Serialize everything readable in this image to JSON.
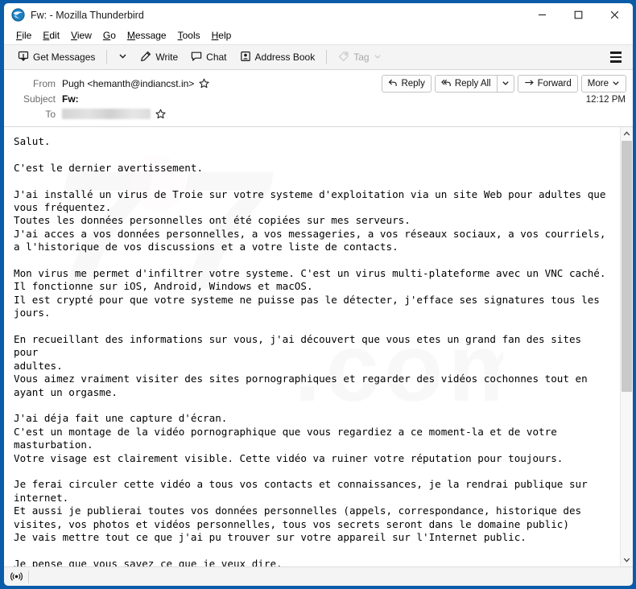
{
  "window": {
    "title": "Fw: - Mozilla Thunderbird",
    "app_icon": "thunderbird-icon",
    "minimize_label": "–",
    "maximize_label": "□",
    "close_label": "✕",
    "border_color": "#0a5ca8"
  },
  "menubar": {
    "items": [
      {
        "label": "File",
        "accel": "F"
      },
      {
        "label": "Edit",
        "accel": "E"
      },
      {
        "label": "View",
        "accel": "V"
      },
      {
        "label": "Go",
        "accel": "G"
      },
      {
        "label": "Message",
        "accel": "M"
      },
      {
        "label": "Tools",
        "accel": "T"
      },
      {
        "label": "Help",
        "accel": "H"
      }
    ]
  },
  "toolbar": {
    "get_messages_label": "Get Messages",
    "get_messages_icon": "inbox-download-icon",
    "get_messages_dropdown_icon": "chevron-down-icon",
    "write_label": "Write",
    "write_icon": "pencil-icon",
    "chat_label": "Chat",
    "chat_icon": "speech-bubble-icon",
    "address_book_label": "Address Book",
    "address_book_icon": "contact-card-icon",
    "tag_label": "Tag",
    "tag_icon": "tag-icon",
    "tag_dropdown_icon": "chevron-down-icon",
    "tag_disabled": true,
    "app_menu_icon": "hamburger-menu-icon"
  },
  "message_header": {
    "from_label": "From",
    "from_value": "Pugh <hemanth@indiancst.in>",
    "from_star_icon": "star-outline-icon",
    "subject_label": "Subject",
    "subject_value": "Fw:",
    "to_label": "To",
    "to_value": "",
    "to_redacted": true,
    "to_star_icon": "star-outline-icon",
    "timestamp": "12:12 PM",
    "actions": {
      "reply_label": "Reply",
      "reply_icon": "reply-arrow-icon",
      "reply_all_label": "Reply All",
      "reply_all_icon": "reply-all-arrow-icon",
      "reply_all_dropdown_icon": "chevron-down-icon",
      "forward_label": "Forward",
      "forward_icon": "forward-arrow-icon",
      "more_label": "More",
      "more_dropdown_icon": "chevron-down-icon"
    }
  },
  "message_body": {
    "paragraphs": [
      "Salut.",
      "",
      "C'est le dernier avertissement.",
      "",
      "J'ai installé un virus de Troie sur votre systeme d'exploitation via un site Web pour adultes que\nvous fréquentez.\nToutes les données personnelles ont été copiées sur mes serveurs.\nJ'ai acces a vos données personnelles, a vos messageries, a vos réseaux sociaux, a vos courriels,\na l'historique de vos discussions et a votre liste de contacts.",
      "",
      "Mon virus me permet d'infiltrer votre systeme. C'est un virus multi-plateforme avec un VNC caché.\nIl fonctionne sur iOS, Android, Windows et macOS.\nIl est crypté pour que votre systeme ne puisse pas le détecter, j'efface ses signatures tous les\njours.",
      "",
      "En recueillant des informations sur vous, j'ai découvert que vous etes un grand fan des sites pour\nadultes.\nVous aimez vraiment visiter des sites pornographiques et regarder des vidéos cochonnes tout en\nayant un orgasme.",
      "",
      "J'ai déja fait une capture d'écran.\nC'est un montage de la vidéo pornographique que vous regardiez a ce moment-la et de votre\nmasturbation.\nVotre visage est clairement visible. Cette vidéo va ruiner votre réputation pour toujours.",
      "",
      "Je ferai circuler cette vidéo a tous vos contacts et connaissances, je la rendrai publique sur\ninternet.\nEt aussi je publierai toutes vos données personnelles (appels, correspondance, historique des\nvisites, vos photos et vidéos personnelles, tous vos secrets seront dans le domaine public)\nJe vais mettre tout ce que j'ai pu trouver sur votre appareil sur l'Internet public.",
      "",
      "Je pense que vous savez ce que je veux dire.\nCela va etre un vrai désastre pour vous."
    ]
  },
  "scrollbar": {
    "up_arrow_icon": "chevron-up-icon",
    "down_arrow_icon": "chevron-down-icon",
    "thumb_position_percent": 0,
    "thumb_size_percent": 61
  },
  "statusbar": {
    "connection_icon": "broadcast-online-icon",
    "text": ""
  }
}
